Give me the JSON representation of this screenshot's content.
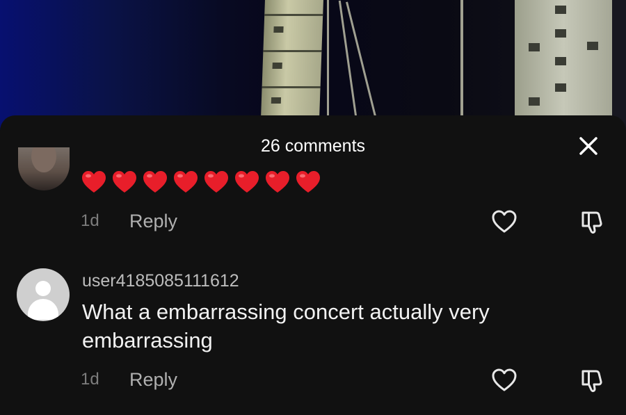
{
  "sheet": {
    "title": "26 comments",
    "close_icon": "close-icon"
  },
  "comments": [
    {
      "avatar": "profile-photo",
      "text_emoji": [
        "red-heart",
        "red-heart",
        "red-heart",
        "red-heart",
        "red-heart",
        "red-heart",
        "red-heart",
        "red-heart"
      ],
      "time": "1d",
      "reply_label": "Reply",
      "like_icon": "heart-outline-icon",
      "dislike_icon": "thumbs-down-icon"
    },
    {
      "avatar": "default-avatar",
      "username": "user4185085111612",
      "text": "What a embarrassing concert actually very embarrassing",
      "time": "1d",
      "reply_label": "Reply",
      "like_icon": "heart-outline-icon",
      "dislike_icon": "thumbs-down-icon"
    }
  ],
  "colors": {
    "sheet_bg": "#111111",
    "heart_red": "#e81e2a",
    "muted_text": "#7d7d7d",
    "username_text": "#bdbdbd"
  }
}
